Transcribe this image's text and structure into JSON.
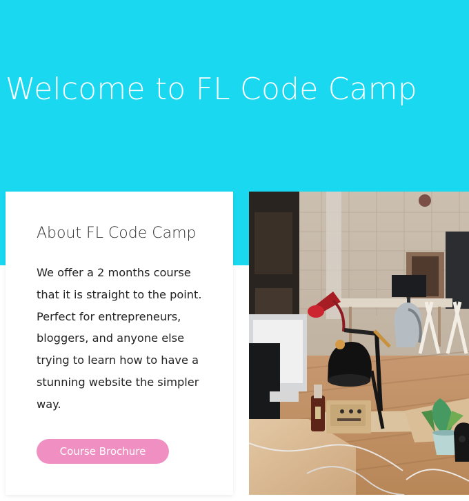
{
  "hero": {
    "title": "Welcome to FL Code Camp"
  },
  "about": {
    "title": "About FL Code Camp",
    "body_lines": [
      "We offer a 2 months course",
      "that it is straight to the point.",
      "Perfect for entrepreneurs,",
      "bloggers, and  anyone else",
      "trying to learn how to have a",
      "stunning  website the simpler",
      "way."
    ],
    "button_label": "Course Brochure"
  },
  "photo": {
    "subject": "office workspace with red desk lamp"
  },
  "colors": {
    "hero_background": "#19d8f0",
    "button_background": "#f090c2",
    "text_dark": "#222222",
    "text_white": "#ffffff"
  }
}
